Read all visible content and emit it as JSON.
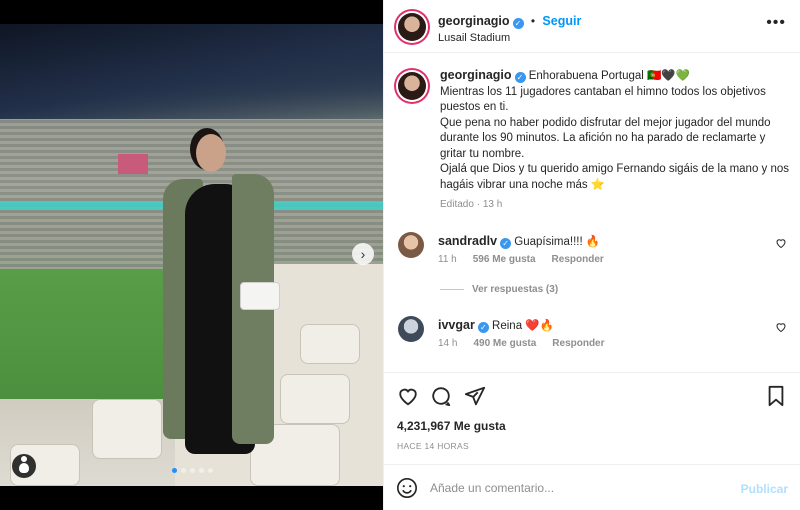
{
  "post": {
    "author": "georginagio",
    "follow_label": "Seguir",
    "location": "Lusail Stadium",
    "more_label": "•••",
    "next_label": "›",
    "carousel": {
      "count": 5,
      "active_index": 0
    }
  },
  "caption": {
    "author": "georginagio",
    "text": "Enhorabuena Portugal 🇵🇹🖤💚\nMientras los 11 jugadores cantaban el himno todos los objetivos puestos en ti.\nQue pena no haber podido disfrutar del mejor jugador del mundo durante los 90 minutos. La afición no ha parado de reclamarte y gritar tu nombre.\nOjalá que Dios y tu querido amigo Fernando sigáis de la mano y nos hagáis vibrar una noche más ⭐",
    "edited": "Editado",
    "time": "13 h"
  },
  "comments": [
    {
      "author": "sandradlv",
      "text": "Guapísima!!!! 🔥",
      "time": "11 h",
      "likes": "596 Me gusta",
      "reply": "Responder",
      "verified": true
    },
    {
      "author": "ivvgar",
      "text": "Reina ❤️🔥",
      "time": "14 h",
      "likes": "490 Me gusta",
      "reply": "Responder",
      "verified": true
    }
  ],
  "view_replies": "Ver respuestas (3)",
  "likes_count": "4,231,967 Me gusta",
  "posted_ago": "HACE 14 HORAS",
  "composer": {
    "placeholder": "Añade un comentario...",
    "post_label": "Publicar"
  },
  "colors": {
    "accent": "#0095f6",
    "verified": "#3897f0",
    "muted": "#8e8e8e"
  }
}
